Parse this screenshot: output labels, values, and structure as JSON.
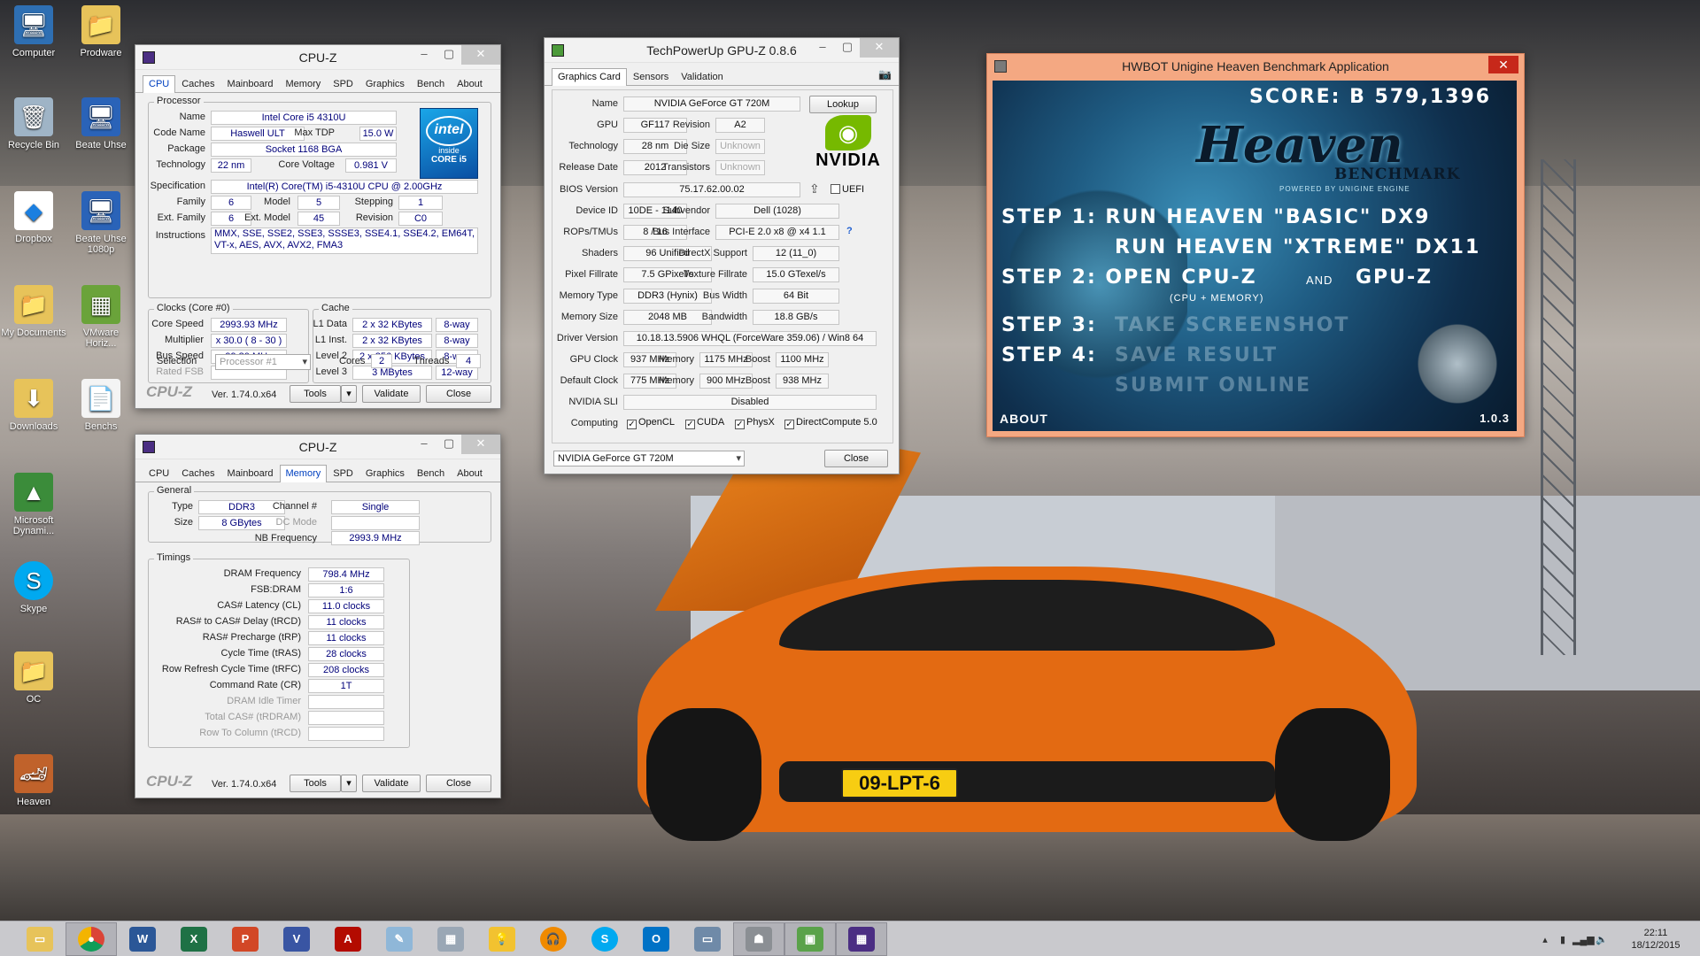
{
  "desktop": {
    "icons": [
      {
        "label": "Computer"
      },
      {
        "label": "Prodware"
      },
      {
        "label": "Recycle Bin"
      },
      {
        "label": "Beate Uhse"
      },
      {
        "label": "Dropbox"
      },
      {
        "label": "Beate Uhse 1080p"
      },
      {
        "label": "My Documents"
      },
      {
        "label": "VMware Horiz..."
      },
      {
        "label": "Downloads"
      },
      {
        "label": "Benchs"
      },
      {
        "label": "Microsoft Dynami..."
      },
      {
        "label": "Skype"
      },
      {
        "label": "OC"
      },
      {
        "label": "Heaven"
      }
    ],
    "plate": "09-LPT-6"
  },
  "cpuz1": {
    "title": "CPU-Z",
    "tabs": [
      "CPU",
      "Caches",
      "Mainboard",
      "Memory",
      "SPD",
      "Graphics",
      "Bench",
      "About"
    ],
    "processor": {
      "group": "Processor",
      "name_l": "Name",
      "name": "Intel Core i5 4310U",
      "code_l": "Code Name",
      "code": "Haswell ULT",
      "tdp_l": "Max TDP",
      "tdp": "15.0 W",
      "pkg_l": "Package",
      "pkg": "Socket 1168 BGA",
      "tech_l": "Technology",
      "tech": "22 nm",
      "volt_l": "Core Voltage",
      "volt": "0.981 V",
      "spec_l": "Specification",
      "spec": "Intel(R) Core(TM) i5-4310U CPU @ 2.00GHz",
      "fam_l": "Family",
      "fam": "6",
      "model_l": "Model",
      "model": "5",
      "step_l": "Stepping",
      "step": "1",
      "efam_l": "Ext. Family",
      "efam": "6",
      "emodel_l": "Ext. Model",
      "emodel": "45",
      "rev_l": "Revision",
      "rev": "C0",
      "instr_l": "Instructions",
      "instr": "MMX, SSE, SSE2, SSE3, SSSE3, SSE4.1, SSE4.2, EM64T, VT-x, AES, AVX, AVX2, FMA3",
      "logo_brand": "intel",
      "logo_inside": "inside",
      "logo_line": "CORE i5"
    },
    "clocks": {
      "group": "Clocks (Core #0)",
      "speed_l": "Core Speed",
      "speed": "2993.93 MHz",
      "mult_l": "Multiplier",
      "mult": "x 30.0 ( 8 - 30 )",
      "bus_l": "Bus Speed",
      "bus": "99.80 MHz",
      "fsb_l": "Rated FSB",
      "fsb": ""
    },
    "cache": {
      "group": "Cache",
      "l1d_l": "L1 Data",
      "l1d": "2 x 32 KBytes",
      "l1d_w": "8-way",
      "l1i_l": "L1 Inst.",
      "l1i": "2 x 32 KBytes",
      "l1i_w": "8-way",
      "l2_l": "Level 2",
      "l2": "2 x 256 KBytes",
      "l2_w": "8-way",
      "l3_l": "Level 3",
      "l3": "3 MBytes",
      "l3_w": "12-way"
    },
    "selection_l": "Selection",
    "selection": "Processor #1",
    "cores_l": "Cores",
    "cores": "2",
    "threads_l": "Threads",
    "threads": "4",
    "brand": "CPU-Z",
    "version": "Ver. 1.74.0.x64",
    "tools": "Tools",
    "validate": "Validate",
    "close": "Close"
  },
  "cpuz2": {
    "title": "CPU-Z",
    "tabs": [
      "CPU",
      "Caches",
      "Mainboard",
      "Memory",
      "SPD",
      "Graphics",
      "Bench",
      "About"
    ],
    "general": {
      "group": "General",
      "type_l": "Type",
      "type": "DDR3",
      "chan_l": "Channel #",
      "chan": "Single",
      "size_l": "Size",
      "size": "8 GBytes",
      "dc_l": "DC Mode",
      "dc": "",
      "nb_l": "NB Frequency",
      "nb": "2993.9 MHz"
    },
    "timings": {
      "group": "Timings",
      "rows": [
        {
          "label": "DRAM Frequency",
          "value": "798.4 MHz"
        },
        {
          "label": "FSB:DRAM",
          "value": "1:6"
        },
        {
          "label": "CAS# Latency (CL)",
          "value": "11.0 clocks"
        },
        {
          "label": "RAS# to CAS# Delay (tRCD)",
          "value": "11 clocks"
        },
        {
          "label": "RAS# Precharge (tRP)",
          "value": "11 clocks"
        },
        {
          "label": "Cycle Time (tRAS)",
          "value": "28 clocks"
        },
        {
          "label": "Row Refresh Cycle Time (tRFC)",
          "value": "208 clocks"
        },
        {
          "label": "Command Rate (CR)",
          "value": "1T"
        },
        {
          "label": "DRAM Idle Timer",
          "value": ""
        },
        {
          "label": "Total CAS# (tRDRAM)",
          "value": ""
        },
        {
          "label": "Row To Column (tRCD)",
          "value": ""
        }
      ]
    },
    "brand": "CPU-Z",
    "version": "Ver. 1.74.0.x64",
    "tools": "Tools",
    "validate": "Validate",
    "close": "Close"
  },
  "gpuz": {
    "title": "TechPowerUp GPU-Z 0.8.6",
    "tabs": [
      "Graphics Card",
      "Sensors",
      "Validation"
    ],
    "name_l": "Name",
    "name": "NVIDIA GeForce GT 720M",
    "lookup": "Lookup",
    "gpu_l": "GPU",
    "gpu": "GF117",
    "rev_l": "Revision",
    "rev": "A2",
    "tech_l": "Technology",
    "tech": "28 nm",
    "die_l": "Die Size",
    "die": "Unknown",
    "rel_l": "Release Date",
    "rel": "2012",
    "trans_l": "Transistors",
    "trans": "Unknown",
    "bios_l": "BIOS Version",
    "bios": "75.17.62.00.02",
    "uefi": "UEFI",
    "dev_l": "Device ID",
    "dev": "10DE - 1140",
    "subv_l": "Subvendor",
    "subv": "Dell (1028)",
    "rops_l": "ROPs/TMUs",
    "rops": "8 / 16",
    "busi_l": "Bus Interface",
    "busi": "PCI-E 2.0 x8 @ x4 1.1",
    "help": "?",
    "shad_l": "Shaders",
    "shad": "96 Unified",
    "dx_l": "DirectX Support",
    "dx": "12 (11_0)",
    "pix_l": "Pixel Fillrate",
    "pix": "7.5 GPixel/s",
    "tex_l": "Texture Fillrate",
    "tex": "15.0 GTexel/s",
    "mtype_l": "Memory Type",
    "mtype": "DDR3 (Hynix)",
    "bw_l": "Bus Width",
    "bw": "64 Bit",
    "msize_l": "Memory Size",
    "msize": "2048 MB",
    "band_l": "Bandwidth",
    "band": "18.8 GB/s",
    "drv_l": "Driver Version",
    "drv": "10.18.13.5906 WHQL (ForceWare 359.06) / Win8 64",
    "gclk_l": "GPU Clock",
    "gclk": "937 MHz",
    "mem_l": "Memory",
    "mem": "1175 MHz",
    "boost_l": "Boost",
    "boost": "1100 MHz",
    "dclk_l": "Default Clock",
    "dclk": "775 MHz",
    "dmem_l": "Memory",
    "dmem": "900 MHz",
    "dboost_l": "Boost",
    "dboost": "938 MHz",
    "sli_l": "NVIDIA SLI",
    "sli": "Disabled",
    "comp_l": "Computing",
    "opencl": "OpenCL",
    "cuda": "CUDA",
    "physx": "PhysX",
    "dc": "DirectCompute 5.0",
    "select": "NVIDIA GeForce GT 720M",
    "close": "Close",
    "logo": "NVIDIA"
  },
  "heaven": {
    "title": "HWBOT Unigine Heaven Benchmark Application",
    "score": "SCORE: B 579,1396",
    "brand_main": "Heaven",
    "brand_sub": "BENCHMARK",
    "brand_pow": "POWERED BY UNIGINE ENGINE",
    "step1": "STEP 1:  RUN HEAVEN \"BASIC\" DX9",
    "step1b": "RUN HEAVEN \"XTREME\" DX11",
    "step2a": "STEP 2: OPEN CPU-Z",
    "step2and": "AND",
    "step2b": "GPU-Z",
    "step2c": "(CPU + MEMORY)",
    "step3a": "STEP 3:",
    "step3b": "TAKE SCREENSHOT",
    "step4a": "STEP 4:",
    "step4b": "SAVE RESULT",
    "submit": "SUBMIT ONLINE",
    "about": "ABOUT",
    "version": "1.0.3"
  },
  "taskbar": {
    "time": "22:11",
    "date": "18/12/2015"
  },
  "colors": {
    "accent_blue": "#0040c0",
    "nvidia_green": "#76b900",
    "heaven_title": "#f4a882",
    "car_orange": "#e36a12"
  }
}
